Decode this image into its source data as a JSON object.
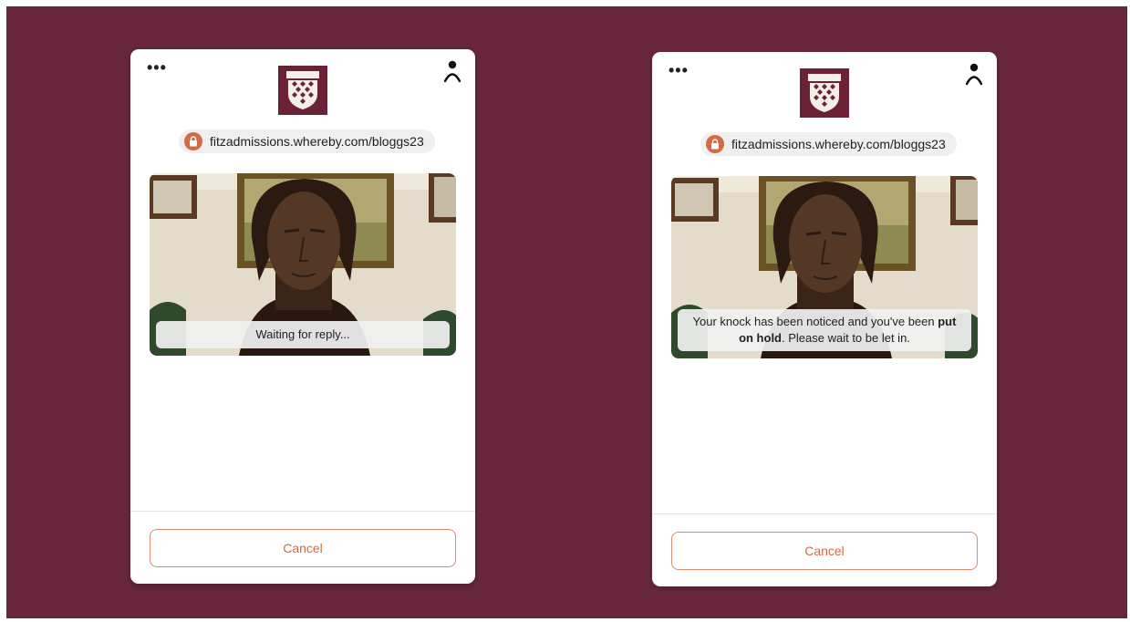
{
  "colors": {
    "background": "#68263c",
    "accent": "#d46a44",
    "crest": "#6b2237"
  },
  "icons": {
    "menu": "more-horizontal-icon",
    "user": "person-icon",
    "lock": "lock-icon",
    "crest": "college-crest-icon"
  },
  "panels": [
    {
      "menu_label": "•••",
      "url": "fitzadmissions.whereby.com/bloggs23",
      "status_before": "Waiting for reply...",
      "status_bold": "",
      "status_after": "",
      "cancel_label": "Cancel"
    },
    {
      "menu_label": "•••",
      "url": "fitzadmissions.whereby.com/bloggs23",
      "status_before": "Your knock has been noticed and you've been ",
      "status_bold": "put on hold",
      "status_after": ". Please wait to be let in.",
      "cancel_label": "Cancel"
    }
  ]
}
